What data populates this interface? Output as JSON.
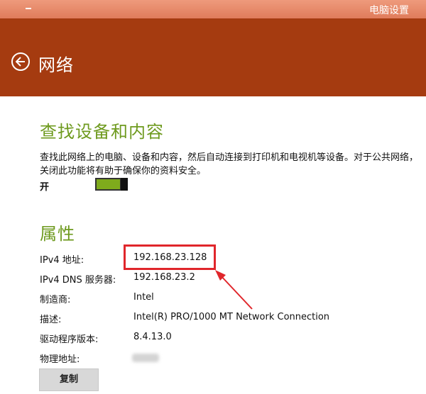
{
  "titlebar": {
    "app_title": "电脑设置"
  },
  "header": {
    "title": "网络"
  },
  "discovery": {
    "heading": "查找设备和内容",
    "description": "查找此网络上的电脑、设备和内容，然后自动连接到打印机和电视机等设备。对于公共网络，关闭此功能将有助于确保你的资料安全。",
    "toggle_label": "开",
    "toggle_on": true
  },
  "properties": {
    "heading": "属性",
    "items": [
      {
        "label": "IPv4 地址:",
        "value": "192.168.23.128"
      },
      {
        "label": "IPv4 DNS 服务器:",
        "value": "192.168.23.2"
      },
      {
        "label": "制造商:",
        "value": "Intel"
      },
      {
        "label": "描述:",
        "value": "Intel(R) PRO/1000 MT Network Connection"
      },
      {
        "label": "驱动程序版本:",
        "value": "8.4.13.0"
      },
      {
        "label": "物理地址:",
        "value": ""
      }
    ],
    "copy_label": "复制"
  },
  "annotation": {
    "color": "#e0262b"
  },
  "colors": {
    "header": "#a53b10",
    "accent": "#6e9a1e",
    "toggle": "#7fab1c"
  }
}
